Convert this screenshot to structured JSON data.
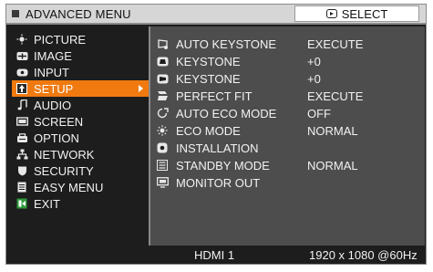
{
  "header": {
    "title": "ADVANCED MENU",
    "select_hint": "SELECT",
    "title_icon": "square-bullet-icon",
    "select_icon": "enter-button-icon"
  },
  "left_menu": [
    {
      "label": "PICTURE",
      "icon": "picture-icon"
    },
    {
      "label": "IMAGE",
      "icon": "image-icon"
    },
    {
      "label": "INPUT",
      "icon": "input-icon"
    },
    {
      "label": "SETUP",
      "icon": "setup-icon",
      "active": true
    },
    {
      "label": "AUDIO",
      "icon": "music-note-icon"
    },
    {
      "label": "SCREEN",
      "icon": "screen-icon"
    },
    {
      "label": "OPTION",
      "icon": "option-icon"
    },
    {
      "label": "NETWORK",
      "icon": "network-icon"
    },
    {
      "label": "SECURITY",
      "icon": "shield-icon"
    },
    {
      "label": "EASY MENU",
      "icon": "easy-menu-icon"
    },
    {
      "label": "EXIT",
      "icon": "exit-icon"
    }
  ],
  "setup_items": [
    {
      "label": "AUTO KEYSTONE",
      "value": "EXECUTE",
      "icon": "auto-keystone-icon"
    },
    {
      "label": "KEYSTONE",
      "value": "+0",
      "icon": "keystone-vertical-icon"
    },
    {
      "label": "KEYSTONE",
      "value": "+0",
      "icon": "keystone-horizontal-icon"
    },
    {
      "label": "PERFECT FIT",
      "value": "EXECUTE",
      "icon": "perfect-fit-icon"
    },
    {
      "label": "AUTO ECO MODE",
      "value": "OFF",
      "icon": "auto-eco-icon"
    },
    {
      "label": "ECO MODE",
      "value": "NORMAL",
      "icon": "eco-sun-icon"
    },
    {
      "label": "INSTALLATION",
      "value": "",
      "icon": "installation-icon"
    },
    {
      "label": "STANDBY MODE",
      "value": "NORMAL",
      "icon": "standby-icon"
    },
    {
      "label": "MONITOR OUT",
      "value": "",
      "icon": "monitor-out-icon"
    }
  ],
  "footer": {
    "source": "HDMI 1",
    "resolution": "1920 x 1080 @60Hz"
  },
  "colors": {
    "active": "#f07a10",
    "background": "#1d1d1d",
    "panel": "#4d4d4d",
    "header": "#d6d6d6"
  }
}
